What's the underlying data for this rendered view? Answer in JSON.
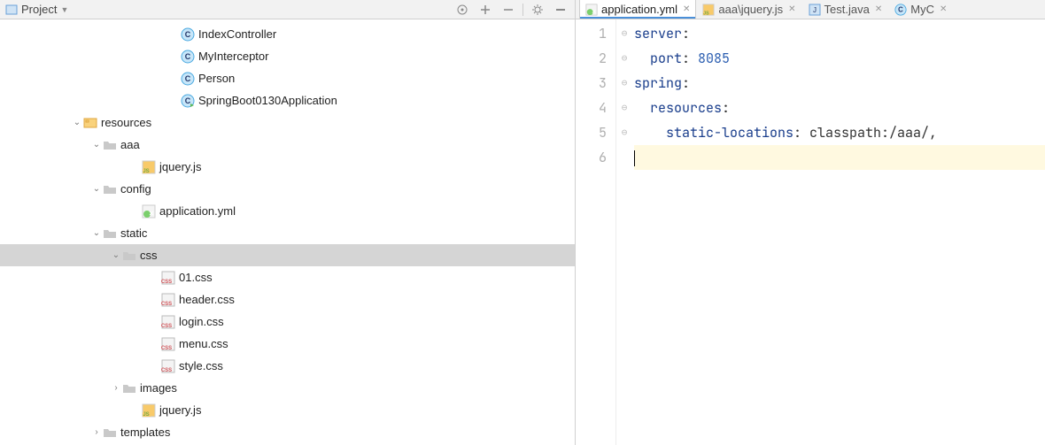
{
  "project_label": "Project",
  "tree": [
    {
      "indent": 190,
      "arrow": "",
      "icon": "class",
      "label": "IndexController",
      "selected": false,
      "interact": true
    },
    {
      "indent": 190,
      "arrow": "",
      "icon": "class",
      "label": "MyInterceptor",
      "selected": false,
      "interact": true
    },
    {
      "indent": 190,
      "arrow": "",
      "icon": "class",
      "label": "Person",
      "selected": false,
      "interact": true
    },
    {
      "indent": 190,
      "arrow": "",
      "icon": "mainclass",
      "label": "SpringBoot0130Application",
      "selected": false,
      "interact": true
    },
    {
      "indent": 80,
      "arrow": "v",
      "icon": "resources",
      "label": "resources",
      "selected": false,
      "interact": true
    },
    {
      "indent": 102,
      "arrow": "v",
      "icon": "folder",
      "label": "aaa",
      "selected": false,
      "interact": true
    },
    {
      "indent": 146,
      "arrow": "",
      "icon": "js",
      "label": "jquery.js",
      "selected": false,
      "interact": true
    },
    {
      "indent": 102,
      "arrow": "v",
      "icon": "folder",
      "label": "config",
      "selected": false,
      "interact": true
    },
    {
      "indent": 146,
      "arrow": "",
      "icon": "yml",
      "label": "application.yml",
      "selected": false,
      "interact": true
    },
    {
      "indent": 102,
      "arrow": "v",
      "icon": "folder",
      "label": "static",
      "selected": false,
      "interact": true
    },
    {
      "indent": 124,
      "arrow": "v",
      "icon": "folder",
      "label": "css",
      "selected": true,
      "interact": true
    },
    {
      "indent": 168,
      "arrow": "",
      "icon": "css",
      "label": "01.css",
      "selected": false,
      "interact": true
    },
    {
      "indent": 168,
      "arrow": "",
      "icon": "css",
      "label": "header.css",
      "selected": false,
      "interact": true
    },
    {
      "indent": 168,
      "arrow": "",
      "icon": "css",
      "label": "login.css",
      "selected": false,
      "interact": true
    },
    {
      "indent": 168,
      "arrow": "",
      "icon": "css",
      "label": "menu.css",
      "selected": false,
      "interact": true
    },
    {
      "indent": 168,
      "arrow": "",
      "icon": "css",
      "label": "style.css",
      "selected": false,
      "interact": true
    },
    {
      "indent": 124,
      "arrow": ">",
      "icon": "folder",
      "label": "images",
      "selected": false,
      "interact": true
    },
    {
      "indent": 146,
      "arrow": "",
      "icon": "js",
      "label": "jquery.js",
      "selected": false,
      "interact": true
    },
    {
      "indent": 102,
      "arrow": ">",
      "icon": "folder",
      "label": "templates",
      "selected": false,
      "interact": true
    }
  ],
  "tabs": [
    {
      "icon": "yml",
      "label": "application.yml",
      "active": true
    },
    {
      "icon": "js",
      "label": "aaa\\jquery.js",
      "active": false
    },
    {
      "icon": "java",
      "label": "Test.java",
      "active": false
    },
    {
      "icon": "class",
      "label": "MyC",
      "active": false
    }
  ],
  "code": {
    "lines": [
      {
        "n": "1",
        "fold": "⊖",
        "segments": [
          {
            "t": "server",
            "c": "kw"
          },
          {
            "t": ":",
            "c": "plain"
          }
        ]
      },
      {
        "n": "2",
        "fold": "⊖",
        "segments": [
          {
            "t": "  port",
            "c": "kw"
          },
          {
            "t": ": ",
            "c": "plain"
          },
          {
            "t": "8085",
            "c": "num"
          }
        ]
      },
      {
        "n": "3",
        "fold": "⊖",
        "segments": [
          {
            "t": "spring",
            "c": "kw"
          },
          {
            "t": ":",
            "c": "plain"
          }
        ]
      },
      {
        "n": "4",
        "fold": "⊖",
        "segments": [
          {
            "t": "  resources",
            "c": "kw"
          },
          {
            "t": ":",
            "c": "plain"
          }
        ]
      },
      {
        "n": "5",
        "fold": "⊖",
        "segments": [
          {
            "t": "    static-locations",
            "c": "kw"
          },
          {
            "t": ": classpath:/aaa/,",
            "c": "plain"
          }
        ]
      },
      {
        "n": "6",
        "fold": "",
        "caret": true,
        "segments": []
      }
    ]
  }
}
